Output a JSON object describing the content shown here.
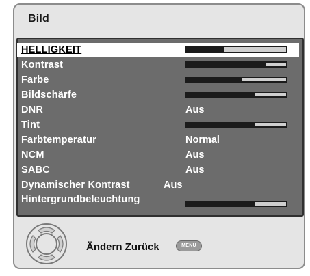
{
  "window": {
    "title": "Bild"
  },
  "menu": {
    "items": [
      {
        "label": "HELLIGKEIT",
        "type": "slider",
        "level_percent": 37,
        "selected": true
      },
      {
        "label": "Kontrast",
        "type": "slider",
        "level_percent": 80
      },
      {
        "label": "Farbe",
        "type": "slider",
        "level_percent": 56
      },
      {
        "label": "Bildschärfe",
        "type": "slider",
        "level_percent": 68
      },
      {
        "label": "DNR",
        "type": "value",
        "value": "Aus"
      },
      {
        "label": "Tint",
        "type": "slider",
        "level_percent": 68
      },
      {
        "label": "Farbtemperatur",
        "type": "value",
        "value": "Normal"
      },
      {
        "label": "NCM",
        "type": "value",
        "value": "Aus"
      },
      {
        "label": "SABC",
        "type": "value",
        "value": "Aus"
      },
      {
        "label": "Dynamischer Kontrast",
        "type": "value",
        "value": "Aus"
      },
      {
        "label": "Hintergrundbeleuchtung",
        "type": "slider",
        "level_percent": 68
      }
    ]
  },
  "footer": {
    "hint": "Ändern Zurück",
    "menu_button_label": "MENU",
    "nav_icon": "direction-pad-icon"
  },
  "colors": {
    "panel": "#6c6c6c",
    "frame": "#e5e5e5",
    "slider_fill": "#1b1b1b",
    "slider_remain": "#cfcfcf",
    "selected_row": "#ffffff"
  }
}
